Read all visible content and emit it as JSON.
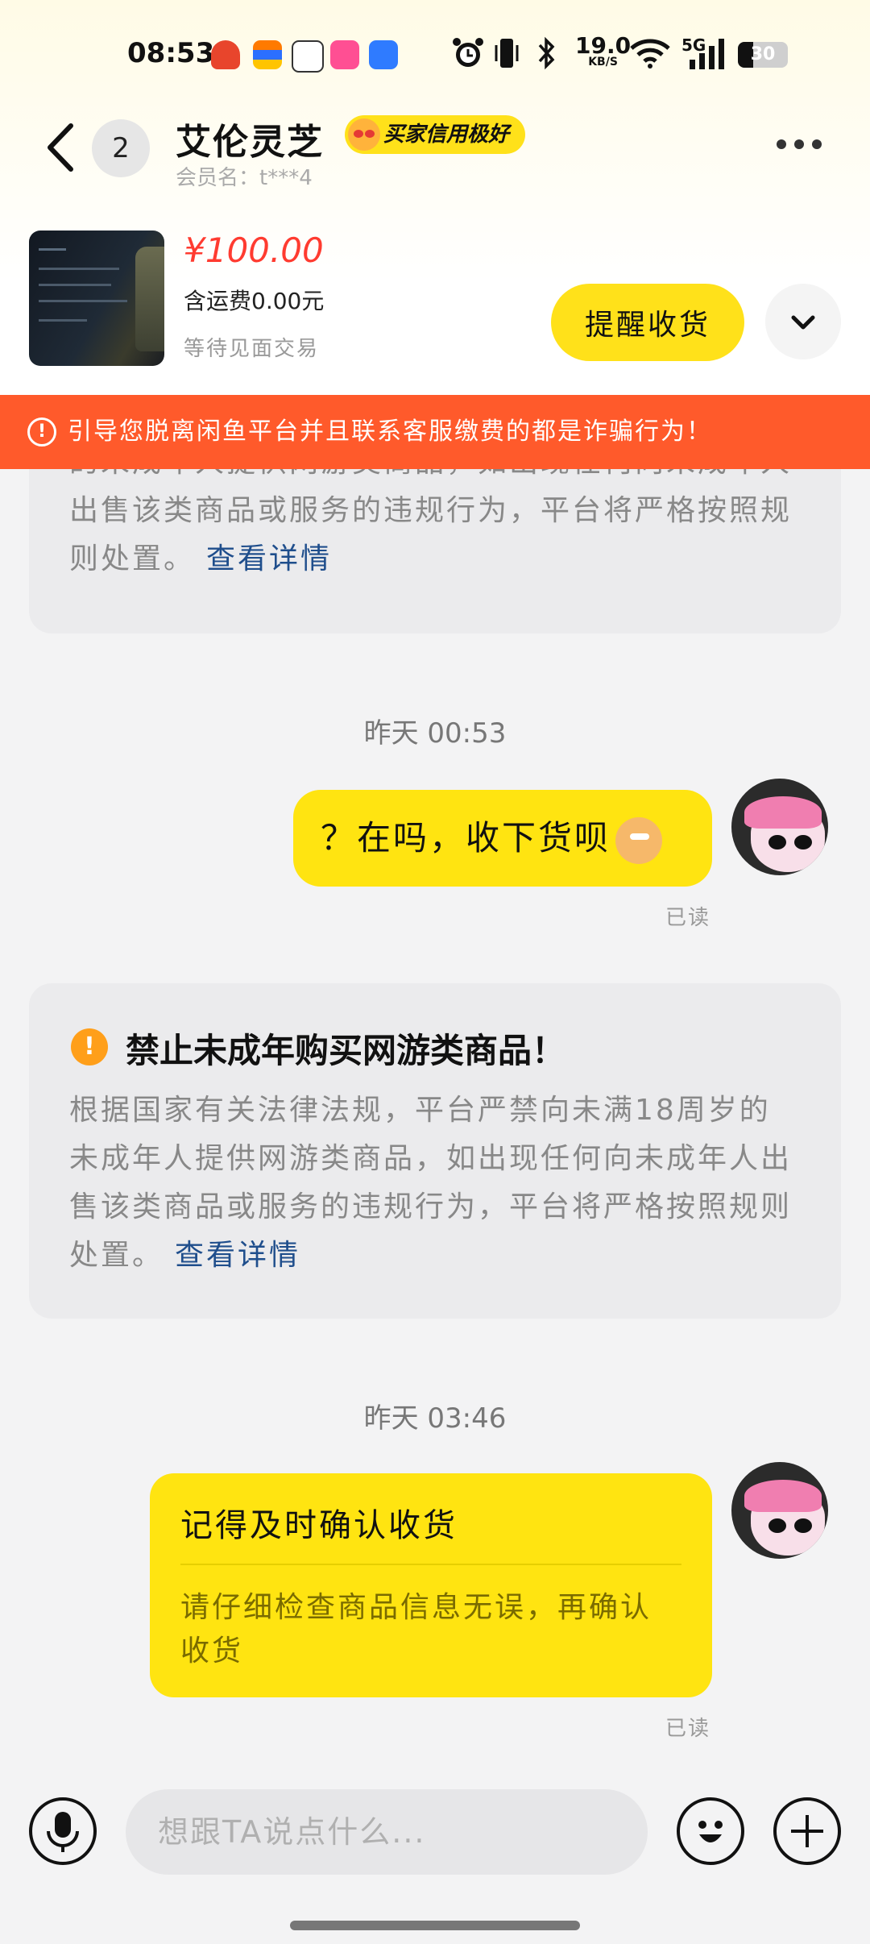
{
  "status": {
    "time": "08:53",
    "net_speed": "19.0",
    "net_unit": "KB/S",
    "signal_label": "5G",
    "battery": "30",
    "app_icons": [
      "app-red-icon",
      "app-stripe-icon",
      "app-video-icon",
      "app-pink-icon",
      "app-blue-icon"
    ],
    "status_icons": [
      "alarm-icon",
      "vibrate-icon",
      "bluetooth-icon",
      "wifi-icon",
      "signal-icon",
      "battery-icon"
    ]
  },
  "header": {
    "unread_count": "2",
    "user_name": "艾伦灵芝",
    "credit_badge": "买家信用极好",
    "member_label": "会员名：t***4"
  },
  "product": {
    "price": "¥100.00",
    "shipping": "含运费0.00元",
    "trade_mode": "等待见面交易",
    "remind_button": "提醒收货"
  },
  "alert_banner": "引导您脱离闲鱼平台并且联系客服缴费的都是诈骗行为！",
  "chat": {
    "notice_partial_body": "的未成年人提供网游类商品，如出现任何向未成年人出售该类商品或服务的违规行为，平台将严格按照规则处置。",
    "notice_partial_link": "查看详情",
    "timestamp_1": "昨天 00:53",
    "message_1": "？在吗，收下货呗",
    "read_1": "已读",
    "notice_title": "禁止未成年购买网游类商品！",
    "notice_body": "根据国家有关法律法规，平台严禁向未满18周岁的未成年人提供网游类商品，如出现任何向未成年人出售该类商品或服务的违规行为，平台将严格按照规则处置。",
    "notice_link": "查看详情",
    "timestamp_2": "昨天 03:46",
    "card_title": "记得及时确认收货",
    "card_body": "请仔细检查商品信息无误，再确认收货",
    "read_2": "已读"
  },
  "input": {
    "placeholder": "想跟TA说点什么..."
  },
  "colors": {
    "accent_yellow": "#ffe411",
    "alert_orange": "#ff5a2b",
    "price_red": "#ff3b30",
    "link_blue": "#1f4e8c"
  }
}
